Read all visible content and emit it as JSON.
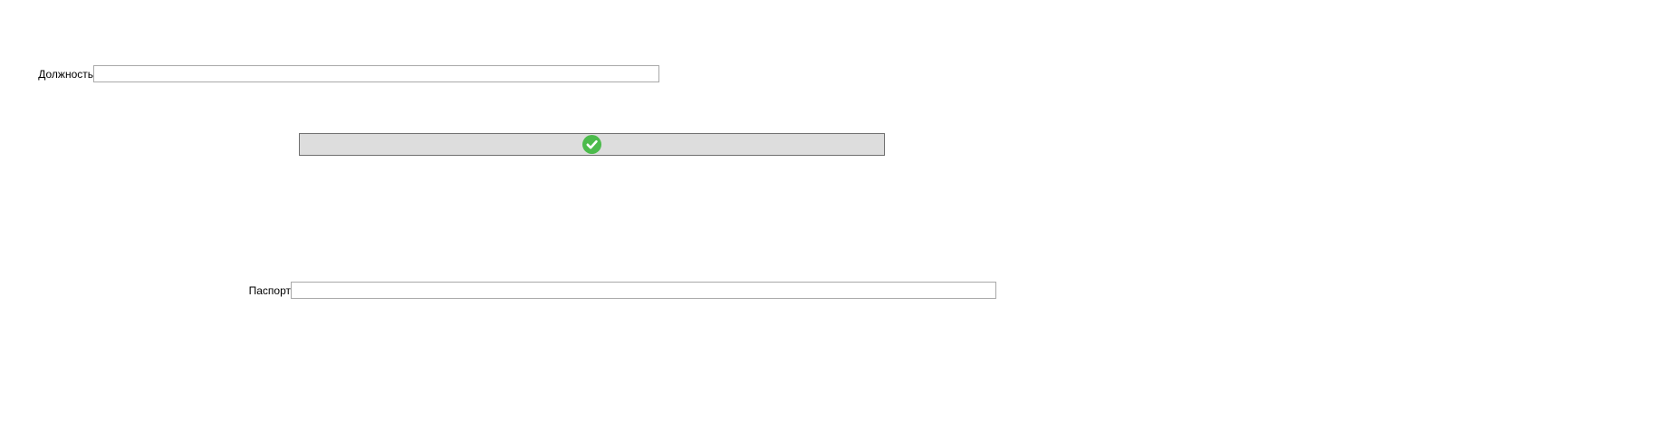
{
  "form": {
    "position_label": "Должность",
    "position_value": "",
    "passport_label": "Паспорт",
    "passport_value": ""
  },
  "confirm_button": {
    "icon": "check-circle-icon",
    "icon_color": "#4cbb4c"
  }
}
